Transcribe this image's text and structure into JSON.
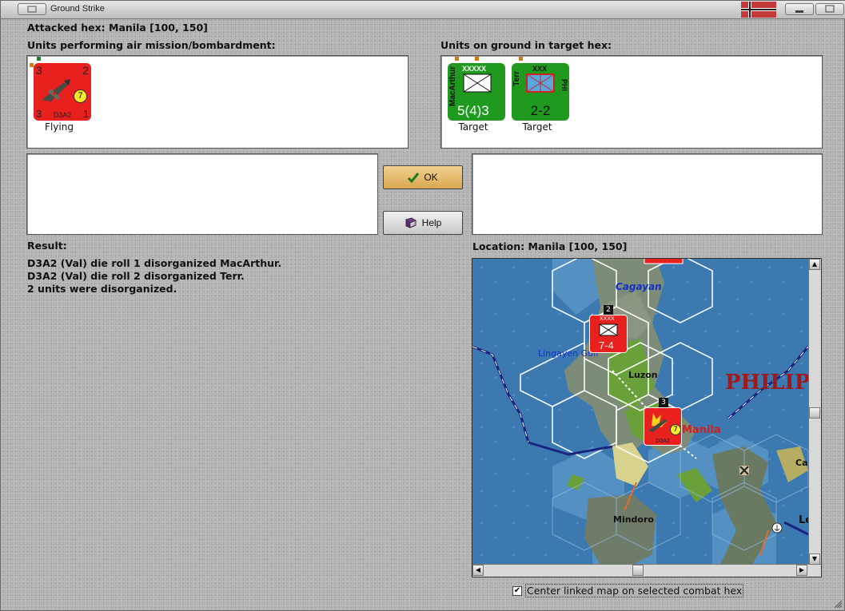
{
  "window": {
    "title": "Ground Strike"
  },
  "header": {
    "attacked_hex": "Attacked hex: Manila  [100, 150]",
    "air_units_label": "Units performing air mission/bombardment:",
    "ground_units_label": "Units on ground in target hex:"
  },
  "air_units": [
    {
      "type_icon": "dive-bomber-icon",
      "name": "D3A2",
      "top_left": "3",
      "top_right": "2",
      "bottom_left": "3",
      "bottom_right": "1",
      "badge": "7",
      "status": "Flying",
      "color": "#e8201e"
    }
  ],
  "ground_units": [
    {
      "side_name": "MacArthur",
      "size": "XXXXX",
      "strength": "5(4)3",
      "status": "Target",
      "color": "#1f9a1f"
    },
    {
      "side_name": "Terr",
      "side_right": "PHI",
      "size": "XXX",
      "strength": "2-2",
      "status": "Target",
      "color": "#1f9a1f"
    }
  ],
  "buttons": {
    "ok": "OK",
    "help": "Help"
  },
  "result": {
    "label": "Result:",
    "lines": [
      "D3A2 (Val) die roll 1 disorganized MacArthur.",
      "D3A2 (Val) die roll 2 disorganized Terr.",
      "2 units were disorganized."
    ]
  },
  "location": {
    "label": "Location:  Manila  [100, 150]"
  },
  "map": {
    "labels": {
      "cagayan": "Cagayan",
      "lingayen": "Lingayen Gulf",
      "luzon": "Luzon",
      "philip": "PHILIP",
      "manila": "Manila",
      "mindoro": "Mindoro",
      "ca": "Ca",
      "le": "Le"
    },
    "counters": {
      "enemy_army_size": "XXXX",
      "enemy_army_strength": "7-4",
      "enemy_army_stack": "2",
      "bomber_stack": "3",
      "bomber_badge": "7",
      "bomber_name": "D3A2"
    }
  },
  "checkbox": {
    "label": "Center linked map on selected combat hex",
    "checked": true,
    "mark": "✔"
  }
}
